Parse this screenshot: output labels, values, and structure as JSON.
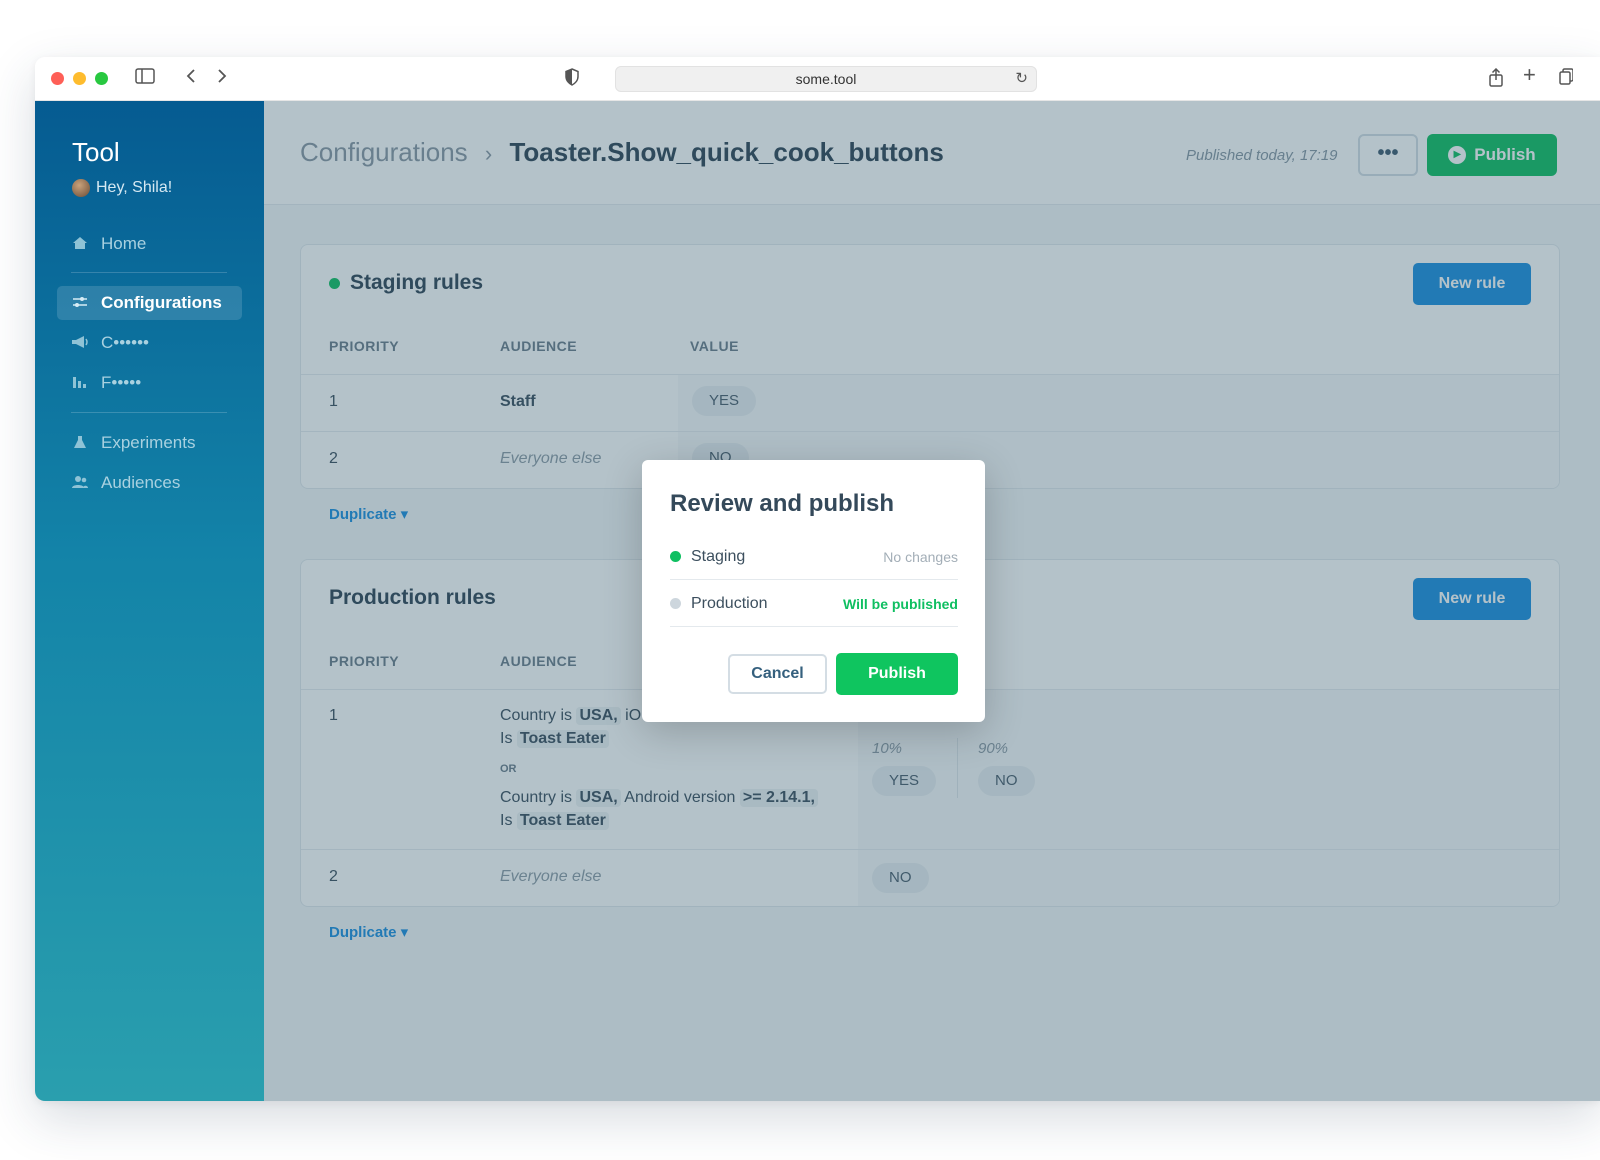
{
  "browser": {
    "url": "some.tool",
    "back_icon": "chevron-left-icon",
    "forward_icon": "chevron-right-icon"
  },
  "sidebar": {
    "brand": "Tool",
    "greeting": "Hey, Shila!",
    "items": [
      {
        "label": "Home",
        "icon": "home-icon"
      },
      {
        "label": "Configurations",
        "icon": "sliders-icon"
      },
      {
        "label": "C••••••",
        "icon": "megaphone-icon"
      },
      {
        "label": "F•••••",
        "icon": "bar-chart-icon"
      },
      {
        "label": "Experiments",
        "icon": "flask-icon"
      },
      {
        "label": "Audiences",
        "icon": "users-icon"
      }
    ]
  },
  "header": {
    "breadcrumb_root": "Configurations",
    "breadcrumb_sep": "›",
    "title": "Toaster.Show_quick_cook_buttons",
    "published": "Published today, 17:19",
    "more_label": "•••",
    "publish_label": "Publish"
  },
  "staging": {
    "title": "Staging rules",
    "new_rule": "New rule",
    "columns": [
      "PRIORITY",
      "AUDIENCE",
      "VALUE"
    ],
    "rows": [
      {
        "priority": "1",
        "audience": "Staff",
        "value": "YES"
      },
      {
        "priority": "2",
        "audience": "Everyone else",
        "value": "NO"
      }
    ],
    "duplicate": "Duplicate ▾"
  },
  "production": {
    "title": "Production rules",
    "new_rule": "New rule",
    "columns": [
      "PRIORITY",
      "AUDIENCE"
    ],
    "rows": [
      {
        "priority": "1",
        "line1_prefix": "Country is",
        "line1_country": "USA,",
        "line1_tail": "iO",
        "line2_prefix": "Is",
        "line2_value": "Toast Eater",
        "or": "OR",
        "line3_prefix": "Country is",
        "line3_country": "USA,",
        "line3_mid": "Android version",
        "line3_version": ">= 2.14.1,",
        "line4_prefix": "Is",
        "line4_value": "Toast Eater",
        "split": [
          {
            "pct": "10%",
            "value": "YES",
            "percent": 10
          },
          {
            "pct": "90%",
            "value": "NO",
            "percent": 90
          }
        ]
      },
      {
        "priority": "2",
        "audience": "Everyone else",
        "value": "NO"
      }
    ],
    "duplicate": "Duplicate ▾"
  },
  "modal": {
    "title": "Review and publish",
    "rows": [
      {
        "name": "Staging",
        "status": "No changes",
        "dot": "#0fbf61"
      },
      {
        "name": "Production",
        "status": "Will be published",
        "dot": "#cdd6dd"
      }
    ],
    "cancel": "Cancel",
    "publish": "Publish"
  }
}
